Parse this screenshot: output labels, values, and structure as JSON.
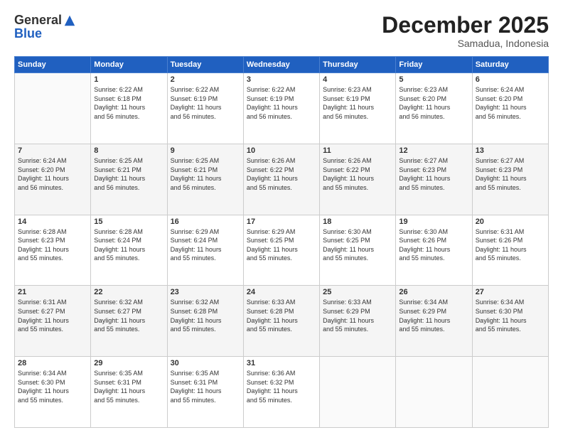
{
  "logo": {
    "general": "General",
    "blue": "Blue"
  },
  "header": {
    "month": "December 2025",
    "location": "Samadua, Indonesia"
  },
  "weekdays": [
    "Sunday",
    "Monday",
    "Tuesday",
    "Wednesday",
    "Thursday",
    "Friday",
    "Saturday"
  ],
  "weeks": [
    [
      {
        "day": "",
        "info": ""
      },
      {
        "day": "1",
        "info": "Sunrise: 6:22 AM\nSunset: 6:18 PM\nDaylight: 11 hours\nand 56 minutes."
      },
      {
        "day": "2",
        "info": "Sunrise: 6:22 AM\nSunset: 6:19 PM\nDaylight: 11 hours\nand 56 minutes."
      },
      {
        "day": "3",
        "info": "Sunrise: 6:22 AM\nSunset: 6:19 PM\nDaylight: 11 hours\nand 56 minutes."
      },
      {
        "day": "4",
        "info": "Sunrise: 6:23 AM\nSunset: 6:19 PM\nDaylight: 11 hours\nand 56 minutes."
      },
      {
        "day": "5",
        "info": "Sunrise: 6:23 AM\nSunset: 6:20 PM\nDaylight: 11 hours\nand 56 minutes."
      },
      {
        "day": "6",
        "info": "Sunrise: 6:24 AM\nSunset: 6:20 PM\nDaylight: 11 hours\nand 56 minutes."
      }
    ],
    [
      {
        "day": "7",
        "info": "Sunrise: 6:24 AM\nSunset: 6:20 PM\nDaylight: 11 hours\nand 56 minutes."
      },
      {
        "day": "8",
        "info": "Sunrise: 6:25 AM\nSunset: 6:21 PM\nDaylight: 11 hours\nand 56 minutes."
      },
      {
        "day": "9",
        "info": "Sunrise: 6:25 AM\nSunset: 6:21 PM\nDaylight: 11 hours\nand 56 minutes."
      },
      {
        "day": "10",
        "info": "Sunrise: 6:26 AM\nSunset: 6:22 PM\nDaylight: 11 hours\nand 55 minutes."
      },
      {
        "day": "11",
        "info": "Sunrise: 6:26 AM\nSunset: 6:22 PM\nDaylight: 11 hours\nand 55 minutes."
      },
      {
        "day": "12",
        "info": "Sunrise: 6:27 AM\nSunset: 6:23 PM\nDaylight: 11 hours\nand 55 minutes."
      },
      {
        "day": "13",
        "info": "Sunrise: 6:27 AM\nSunset: 6:23 PM\nDaylight: 11 hours\nand 55 minutes."
      }
    ],
    [
      {
        "day": "14",
        "info": "Sunrise: 6:28 AM\nSunset: 6:23 PM\nDaylight: 11 hours\nand 55 minutes."
      },
      {
        "day": "15",
        "info": "Sunrise: 6:28 AM\nSunset: 6:24 PM\nDaylight: 11 hours\nand 55 minutes."
      },
      {
        "day": "16",
        "info": "Sunrise: 6:29 AM\nSunset: 6:24 PM\nDaylight: 11 hours\nand 55 minutes."
      },
      {
        "day": "17",
        "info": "Sunrise: 6:29 AM\nSunset: 6:25 PM\nDaylight: 11 hours\nand 55 minutes."
      },
      {
        "day": "18",
        "info": "Sunrise: 6:30 AM\nSunset: 6:25 PM\nDaylight: 11 hours\nand 55 minutes."
      },
      {
        "day": "19",
        "info": "Sunrise: 6:30 AM\nSunset: 6:26 PM\nDaylight: 11 hours\nand 55 minutes."
      },
      {
        "day": "20",
        "info": "Sunrise: 6:31 AM\nSunset: 6:26 PM\nDaylight: 11 hours\nand 55 minutes."
      }
    ],
    [
      {
        "day": "21",
        "info": "Sunrise: 6:31 AM\nSunset: 6:27 PM\nDaylight: 11 hours\nand 55 minutes."
      },
      {
        "day": "22",
        "info": "Sunrise: 6:32 AM\nSunset: 6:27 PM\nDaylight: 11 hours\nand 55 minutes."
      },
      {
        "day": "23",
        "info": "Sunrise: 6:32 AM\nSunset: 6:28 PM\nDaylight: 11 hours\nand 55 minutes."
      },
      {
        "day": "24",
        "info": "Sunrise: 6:33 AM\nSunset: 6:28 PM\nDaylight: 11 hours\nand 55 minutes."
      },
      {
        "day": "25",
        "info": "Sunrise: 6:33 AM\nSunset: 6:29 PM\nDaylight: 11 hours\nand 55 minutes."
      },
      {
        "day": "26",
        "info": "Sunrise: 6:34 AM\nSunset: 6:29 PM\nDaylight: 11 hours\nand 55 minutes."
      },
      {
        "day": "27",
        "info": "Sunrise: 6:34 AM\nSunset: 6:30 PM\nDaylight: 11 hours\nand 55 minutes."
      }
    ],
    [
      {
        "day": "28",
        "info": "Sunrise: 6:34 AM\nSunset: 6:30 PM\nDaylight: 11 hours\nand 55 minutes."
      },
      {
        "day": "29",
        "info": "Sunrise: 6:35 AM\nSunset: 6:31 PM\nDaylight: 11 hours\nand 55 minutes."
      },
      {
        "day": "30",
        "info": "Sunrise: 6:35 AM\nSunset: 6:31 PM\nDaylight: 11 hours\nand 55 minutes."
      },
      {
        "day": "31",
        "info": "Sunrise: 6:36 AM\nSunset: 6:32 PM\nDaylight: 11 hours\nand 55 minutes."
      },
      {
        "day": "",
        "info": ""
      },
      {
        "day": "",
        "info": ""
      },
      {
        "day": "",
        "info": ""
      }
    ]
  ]
}
